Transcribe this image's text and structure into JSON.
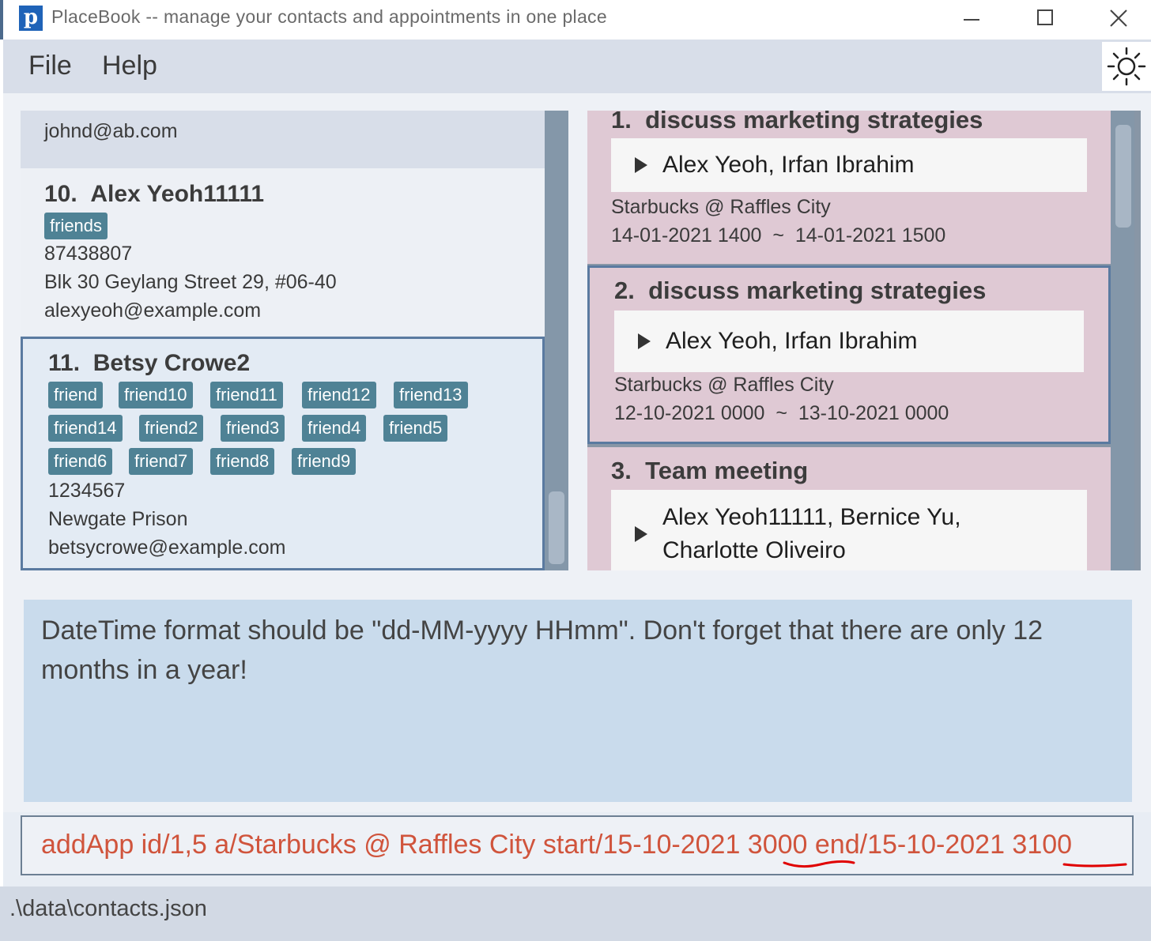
{
  "window": {
    "app_icon_letter": "p",
    "title": "PlaceBook -- manage your contacts and appointments in one place"
  },
  "menu": {
    "file": "File",
    "help": "Help"
  },
  "persons": {
    "partial_email": "johnd@ab.com",
    "alex": {
      "index": "10.",
      "name": "Alex Yeoh11111",
      "tags": [
        "friends"
      ],
      "phone": "87438807",
      "address": "Blk 30 Geylang Street 29, #06-40",
      "email": "alexyeoh@example.com"
    },
    "betsy": {
      "index": "11.",
      "name": "Betsy Crowe2",
      "tags": [
        "friend",
        "friend10",
        "friend11",
        "friend12",
        "friend13",
        "friend14",
        "friend2",
        "friend3",
        "friend4",
        "friend5",
        "friend6",
        "friend7",
        "friend8",
        "friend9"
      ],
      "phone": "1234567",
      "address": "Newgate Prison",
      "email": "betsycrowe@example.com"
    }
  },
  "appointments": [
    {
      "index": "1.",
      "title": "discuss marketing strategies",
      "clients": "Alex Yeoh, Irfan Ibrahim",
      "location": "Starbucks @ Raffles City",
      "start": "14-01-2021 1400",
      "sep": "~",
      "end": "14-01-2021 1500"
    },
    {
      "index": "2.",
      "title": "discuss marketing strategies",
      "clients": "Alex Yeoh, Irfan Ibrahim",
      "location": "Starbucks @ Raffles City",
      "start": "12-10-2021 0000",
      "sep": "~",
      "end": "13-10-2021 0000"
    },
    {
      "index": "3.",
      "title": "Team meeting",
      "clients_line1": "Alex Yeoh11111, Bernice Yu,",
      "clients_line2": "Charlotte Oliveiro"
    }
  ],
  "result": {
    "message": "DateTime format should be \"dd-MM-yyyy HHmm\". Don't forget that there are only 12 months in a year!"
  },
  "command": {
    "value": "addApp id/1,5 a/Starbucks @ Raffles City start/15-10-2021 3000 end/15-10-2021 3100",
    "error_color": "#d0543c"
  },
  "status": {
    "file_path": ".\\data\\contacts.json"
  },
  "colors": {
    "tag_bg": "#4f8295",
    "appointment_bg": "#dfc9d4",
    "result_bg": "#c9dbec",
    "selected_border": "#5a7aa0",
    "spellcheck_underline": "#e00000"
  }
}
